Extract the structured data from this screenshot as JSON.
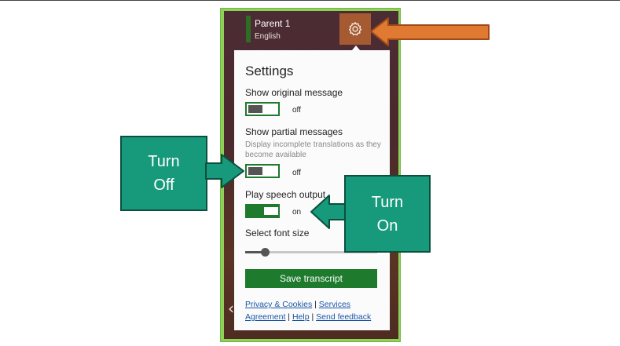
{
  "user": {
    "name": "Parent 1",
    "language": "English"
  },
  "icons": {
    "settings": "gear-icon",
    "back": "chevron-left-icon"
  },
  "settings": {
    "title": "Settings",
    "show_original": {
      "label": "Show original message",
      "state": "off"
    },
    "show_partial": {
      "label": "Show partial messages",
      "description": "Display incomplete translations as they become available",
      "state": "off"
    },
    "play_speech": {
      "label": "Play speech output",
      "state": "on"
    },
    "font_size": {
      "label": "Select font size",
      "value": 0.15
    },
    "save_button": "Save transcript"
  },
  "footer_links": {
    "privacy": "Privacy & Cookies",
    "separator": "|",
    "services": "Services Agreement",
    "help": "Help",
    "feedback": "Send feedback"
  },
  "annotations": {
    "turn_off": {
      "line1": "Turn",
      "line2": "Off"
    },
    "turn_on": {
      "line1": "Turn",
      "line2": "On"
    }
  },
  "colors": {
    "frame_green": "#8ed05a",
    "toggle_green": "#1e7a2c",
    "callout_teal": "#179a7b",
    "highlight_orange": "#e07a33"
  }
}
